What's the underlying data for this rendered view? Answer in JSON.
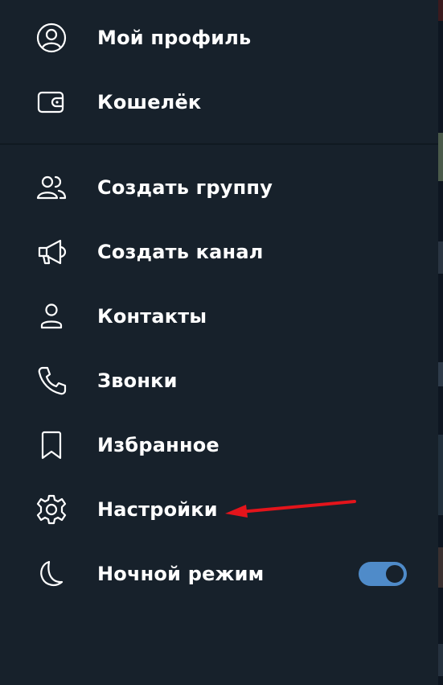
{
  "menu": {
    "profile": {
      "label": "Мой профиль",
      "icon": "user-circle-icon"
    },
    "wallet": {
      "label": "Кошелёк",
      "icon": "wallet-icon"
    },
    "new_group": {
      "label": "Создать группу",
      "icon": "users-icon"
    },
    "new_channel": {
      "label": "Создать канал",
      "icon": "megaphone-icon"
    },
    "contacts": {
      "label": "Контакты",
      "icon": "user-icon"
    },
    "calls": {
      "label": "Звонки",
      "icon": "phone-icon"
    },
    "saved": {
      "label": "Избранное",
      "icon": "bookmark-icon"
    },
    "settings": {
      "label": "Настройки",
      "icon": "gear-icon"
    },
    "night_mode": {
      "label": "Ночной режим",
      "icon": "moon-icon",
      "enabled": true
    }
  },
  "colors": {
    "background": "#17212b",
    "text": "#ffffff",
    "toggle_accent": "#4f8bc9",
    "annotation_arrow": "#e3141b"
  }
}
